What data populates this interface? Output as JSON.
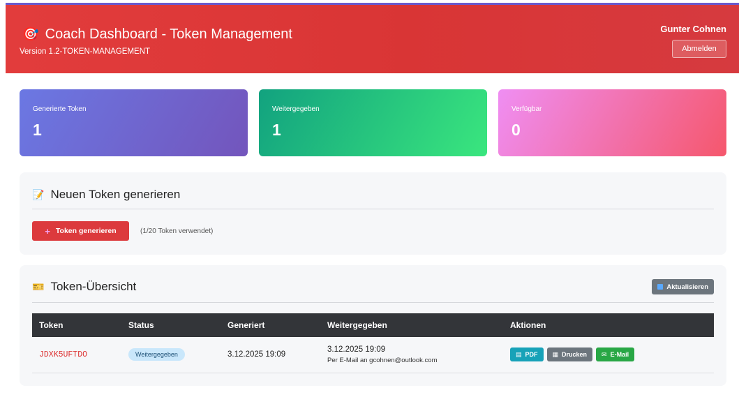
{
  "header": {
    "title": "Coach Dashboard - Token Management",
    "version": "Version 1.2-TOKEN-MANAGEMENT",
    "user": "Gunter Cohnen",
    "logout_label": "Abmelden",
    "icon": "dart-target-icon"
  },
  "stats": [
    {
      "label": "Generierte Token",
      "value": "1"
    },
    {
      "label": "Weitergegeben",
      "value": "1"
    },
    {
      "label": "Verfügbar",
      "value": "0"
    }
  ],
  "generate": {
    "title": "Neuen Token generieren",
    "icon": "memo-pencil-icon",
    "button_label": "Token generieren",
    "used_text": "(1/20 Token verwendet)"
  },
  "overview": {
    "title": "Token-Übersicht",
    "icon": "ticket-icon",
    "refresh_label": "Aktualisieren",
    "columns": [
      "Token",
      "Status",
      "Generiert",
      "Weitergegeben",
      "Aktionen"
    ],
    "rows": [
      {
        "token": "JDXK5UFTDO",
        "status": "Weitergegeben",
        "generated": "3.12.2025 19:09",
        "shared_date": "3.12.2025 19:09",
        "shared_via": "Per E-Mail an gcohnen@outlook.com",
        "actions": {
          "pdf": "PDF",
          "print": "Drucken",
          "email": "E-Mail"
        }
      }
    ]
  },
  "colors": {
    "header_bg": "#e23c3c",
    "primary_red": "#dc3a3d",
    "pdf_btn": "#17a2b8",
    "print_btn": "#6c757d",
    "mail_btn": "#28a745",
    "table_header": "#333539"
  }
}
